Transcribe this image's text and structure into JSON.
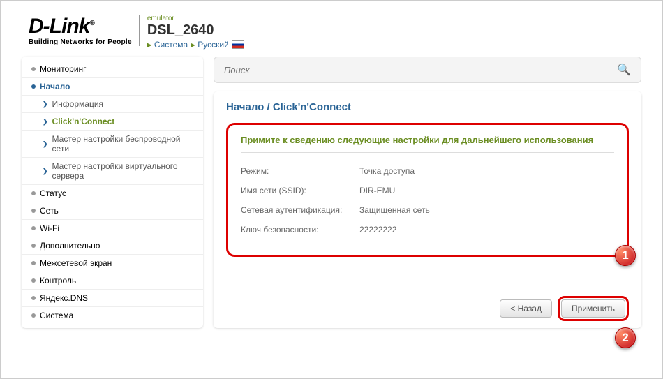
{
  "header": {
    "logo_text": "D-Link",
    "logo_tagline": "Building Networks for People",
    "emulator_label": "emulator",
    "model": "DSL_2640",
    "crumb1": "Система",
    "crumb2": "Русский"
  },
  "search": {
    "placeholder": "Поиск"
  },
  "sidebar": {
    "items": [
      {
        "label": "Мониторинг"
      },
      {
        "label": "Начало",
        "active": true,
        "subs": [
          {
            "label": "Информация"
          },
          {
            "label": "Click'n'Connect",
            "active": true
          },
          {
            "label": "Мастер настройки беспроводной сети"
          },
          {
            "label": "Мастер настройки виртуального сервера"
          }
        ]
      },
      {
        "label": "Статус"
      },
      {
        "label": "Сеть"
      },
      {
        "label": "Wi-Fi"
      },
      {
        "label": "Дополнительно"
      },
      {
        "label": "Межсетевой экран"
      },
      {
        "label": "Контроль"
      },
      {
        "label": "Яндекс.DNS"
      },
      {
        "label": "Система"
      }
    ]
  },
  "main": {
    "breadcrumb": "Начало /  Click'n'Connect",
    "info_title": "Примите к сведению следующие настройки для дальнейшего использования",
    "rows": [
      {
        "label": "Режим:",
        "value": "Точка доступа"
      },
      {
        "label": "Имя сети (SSID):",
        "value": "DIR-EMU"
      },
      {
        "label": "Сетевая аутентификация:",
        "value": "Защищенная сеть"
      },
      {
        "label": "Ключ безопасности:",
        "value": "22222222"
      }
    ],
    "back_button": "< Назад",
    "apply_button": "Применить",
    "marker1": "1",
    "marker2": "2"
  }
}
